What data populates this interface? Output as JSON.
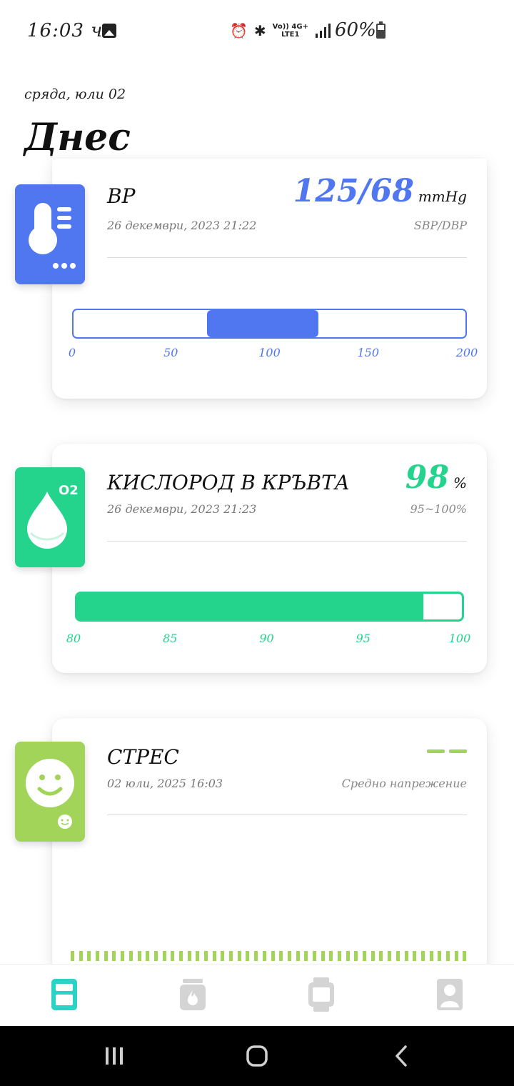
{
  "status_bar": {
    "time": "16:03 ч.",
    "network_top": "Vo)) 4G+",
    "network_bottom": "LTE1",
    "battery": "60%"
  },
  "header": {
    "date": "сряда, юли 02",
    "title": "Днес"
  },
  "bp_card": {
    "title": "BP",
    "timestamp": "26 декември, 2023 21:22",
    "value": "125/68",
    "unit": "mmHg",
    "value_caption": "SBP/DBP",
    "accent": "#5077f0",
    "range_min": 0,
    "range_max": 200,
    "range_low": 68,
    "range_high": 125,
    "ticks": [
      "0",
      "50",
      "100",
      "150",
      "200"
    ]
  },
  "o2_card": {
    "title": "КИСЛОРОД В КРЪВТА",
    "timestamp": "26 декември, 2023 21:23",
    "value": "98",
    "unit": "%",
    "value_caption": "95~100%",
    "accent": "#24d38c",
    "range_min": 80,
    "range_max": 100,
    "level": 98,
    "ticks": [
      "80",
      "85",
      "90",
      "95",
      "100"
    ],
    "tile_label": "O2"
  },
  "stress_card": {
    "title": "СТРЕС",
    "timestamp": "02 юли, 2025 16:03",
    "value": "--",
    "value_caption": "Средно напрежение",
    "accent": "#a2d45a"
  },
  "bottom_nav": {
    "items": [
      {
        "icon": "dashboard-icon",
        "active": true
      },
      {
        "icon": "workout-icon",
        "active": false
      },
      {
        "icon": "watch-icon",
        "active": false
      },
      {
        "icon": "profile-icon",
        "active": false
      }
    ],
    "active_color": "#2bd3c6",
    "inactive_color": "#d4d4d4"
  }
}
